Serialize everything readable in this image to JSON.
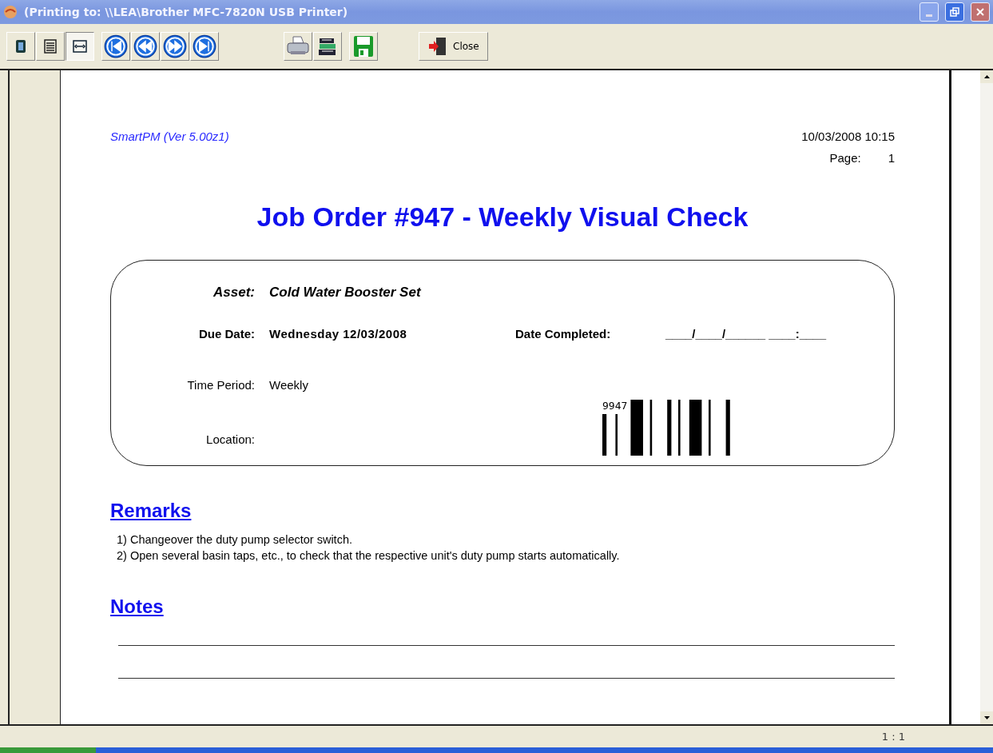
{
  "window": {
    "title": "(Printing to: \\\\LEA\\Brother MFC-7820N USB Printer)"
  },
  "toolbar": {
    "view_buttons": [
      {
        "kind": "one-page",
        "selected": false
      },
      {
        "kind": "text",
        "selected": false
      },
      {
        "kind": "fit",
        "selected": true
      }
    ],
    "nav_buttons": [
      {
        "kind": "first"
      },
      {
        "kind": "prev"
      },
      {
        "kind": "next"
      },
      {
        "kind": "last"
      }
    ],
    "action_buttons": [
      {
        "kind": "print"
      },
      {
        "kind": "setup"
      },
      {
        "kind": "save"
      }
    ],
    "close_label": "Close"
  },
  "document": {
    "app_version": "SmartPM (Ver 5.00z1)",
    "datetime": "10/03/2008 10:15",
    "page_label": "Page:",
    "page_number": "1",
    "title": "Job Order #947 - Weekly Visual Check",
    "asset": {
      "label": "Asset:",
      "value": "Cold Water Booster Set"
    },
    "due_date": {
      "label": "Due Date:",
      "value": "Wednesday 12/03/2008"
    },
    "date_completed": {
      "label": "Date Completed:",
      "value": "____/____/______   ____:____"
    },
    "time_period": {
      "label": "Time Period:",
      "value": "Weekly"
    },
    "location": {
      "label": "Location:"
    },
    "barcode_text": "9947",
    "remarks": {
      "heading": "Remarks",
      "lines": [
        "1) Changeover the duty pump selector switch.",
        "2) Open several basin taps, etc., to check that the respective unit's duty pump starts automatically."
      ]
    },
    "notes": {
      "heading": "Notes"
    }
  },
  "status_bar": {
    "zoom": "1 : 1"
  }
}
